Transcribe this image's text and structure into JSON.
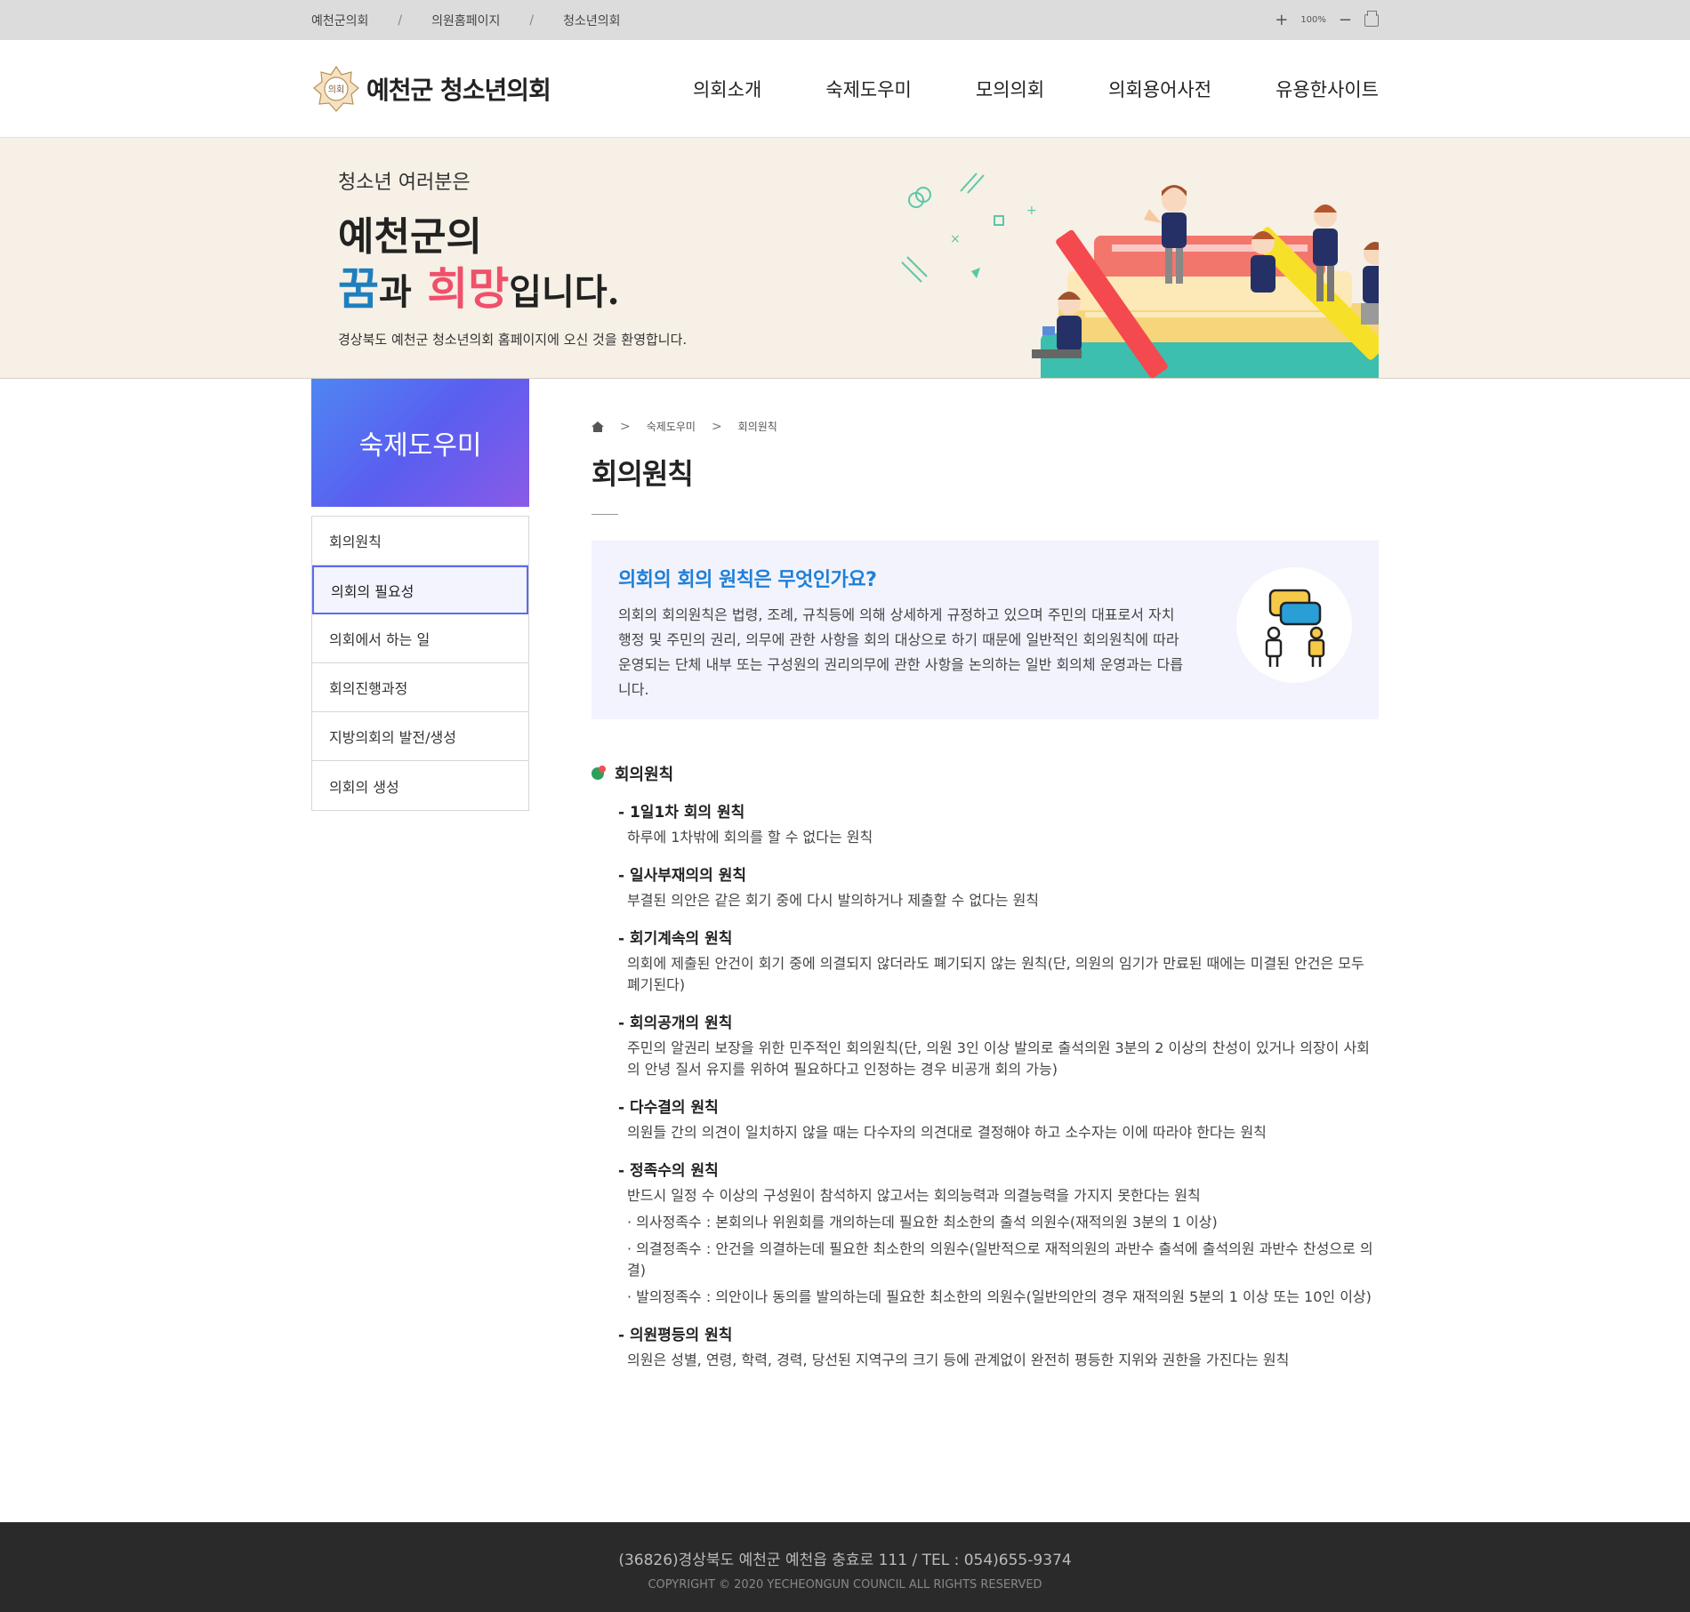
{
  "topbar": {
    "links": [
      "예천군의회",
      "의원홈페이지",
      "청소년의회"
    ],
    "separator": "/",
    "zoom_in": "+",
    "zoom_level": "100%",
    "zoom_out": "−"
  },
  "header": {
    "logo_text": "예천군 청소년의회",
    "emblem_text": "의회",
    "nav": [
      "의회소개",
      "숙제도우미",
      "모의의회",
      "의회용어사전",
      "유용한사이트"
    ]
  },
  "hero": {
    "sub": "청소년 여러분은",
    "line1": "예천군의",
    "dream": "꿈",
    "and": "과",
    "hope": "희망",
    "is": "입니다.",
    "welcome": "경상북도 예천군 청소년의회 홈페이지에 오신 것을 환영합니다."
  },
  "lnb": {
    "title": "숙제도우미",
    "items": [
      "회의원칙",
      "의회의 필요성",
      "의회에서 하는 일",
      "회의진행과정",
      "지방의회의 발전/생성",
      "의회의 생성"
    ],
    "active_index": 1
  },
  "breadcrumb": [
    "숙제도우미",
    "회의원칙"
  ],
  "page_title": "회의원칙",
  "info": {
    "question": "의회의 회의 원칙은 무엇인가요?",
    "text": "의회의 회의원칙은 법령, 조례, 규칙등에 의해 상세하게 규정하고 있으며 주민의 대표로서 자치행정 및 주민의 권리, 의무에 관한 사항을 회의 대상으로 하기 때문에 일반적인 회의원칙에 따라 운영되는 단체 내부 또는 구성원의 권리의무에 관한 사항을 논의하는 일반 회의체 운영과는 다릅니다."
  },
  "section": {
    "title": "회의원칙",
    "rules": [
      {
        "name": "- 1일1차 회의 원칙",
        "desc": "하루에 1차밖에 회의를 할 수 없다는 원칙"
      },
      {
        "name": "- 일사부재의의 원칙",
        "desc": "부결된 의안은 같은 회기 중에 다시 발의하거나 제출할 수 없다는 원칙"
      },
      {
        "name": "- 회기계속의 원칙",
        "desc": "의회에 제출된 안건이 회기 중에 의결되지 않더라도 폐기되지 않는 원칙(단, 의원의 임기가 만료된 때에는 미결된 안건은 모두 폐기된다)"
      },
      {
        "name": "- 회의공개의 원칙",
        "desc": "주민의 알권리 보장을 위한 민주적인 회의원칙(단, 의원 3인 이상 발의로 출석의원 3분의 2 이상의 찬성이 있거나 의장이 사회의 안녕 질서 유지를 위하여 필요하다고 인정하는 경우 비공개 회의 가능)"
      },
      {
        "name": "- 다수결의 원칙",
        "desc": "의원들 간의 의견이 일치하지 않을 때는 다수자의 의견대로 결정해야 하고 소수자는 이에 따라야 한다는 원칙"
      },
      {
        "name": "- 정족수의 원칙",
        "desc": "반드시 일정 수 이상의 구성원이 참석하지 않고서는 회의능력과 의결능력을 가지지 못한다는 원칙",
        "bullets": [
          "· 의사정족수 : 본회의나 위원회를 개의하는데 필요한 최소한의 출석 의원수(재적의원 3분의 1 이상)",
          "· 의결정족수 : 안건을 의결하는데 필요한 최소한의 의원수(일반적으로 재적의원의 과반수 출석에 출석의원 과반수 찬성으로 의결)",
          "· 발의정족수 : 의안이나 동의를 발의하는데 필요한 최소한의 의원수(일반의안의 경우 재적의원 5분의 1 이상 또는 10인 이상)"
        ]
      },
      {
        "name": "- 의원평등의 원칙",
        "desc": "의원은 성별, 연령, 학력, 경력, 당선된 지역구의 크기 등에 관계없이 완전히 평등한 지위와 권한을 가진다는 원칙"
      }
    ]
  },
  "footer": {
    "address": "(36826)경상북도 예천군 예천읍 충효로 111 / TEL : 054)655-9374",
    "copyright": "COPYRIGHT © 2020 YECHEONGUN COUNCIL ALL RIGHTS RESERVED"
  },
  "colors": {
    "accent_blue": "#1f7fd6",
    "hope_pink": "#f0506a",
    "dream_blue": "#1e7fbf",
    "lnb_active_border": "#5b6bef",
    "footer_bg": "#2b2a2a",
    "hero_bg": "#f6f0e6"
  },
  "icons": {
    "home": "home-icon",
    "print": "printer-icon",
    "section_marker": "dot-icon",
    "info": "people-talking-icon"
  }
}
